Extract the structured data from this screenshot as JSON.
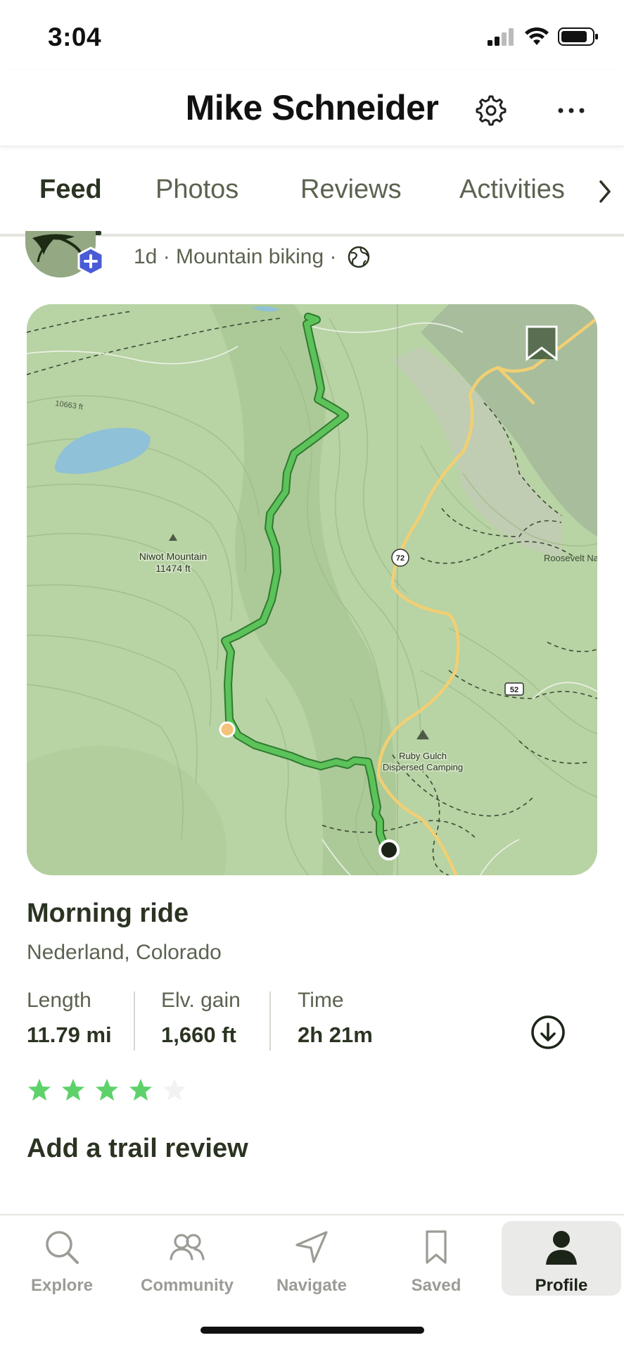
{
  "status_bar": {
    "time": "3:04",
    "icons": [
      "signal-icon",
      "wifi-icon",
      "battery-icon"
    ]
  },
  "header": {
    "title": "Mike Schneider",
    "settings_icon": "gear-icon",
    "more_icon": "ellipsis-icon"
  },
  "tabs": [
    {
      "label": "Feed",
      "active": true
    },
    {
      "label": "Photos",
      "active": false
    },
    {
      "label": "Reviews",
      "active": false
    },
    {
      "label": "Activities",
      "active": false
    }
  ],
  "post": {
    "meta": "1d · Mountain biking ·",
    "visibility_icon": "globe-icon"
  },
  "map": {
    "labels": {
      "elevation": "10663 ft",
      "peak_name": "Niwot Mountain",
      "peak_elevation": "11474 ft",
      "highway_72": "72",
      "highway_52": "52",
      "place": "Roosevelt Na",
      "camp_line1": "Ruby Gulch",
      "camp_line2": "Dispersed Camping"
    },
    "colors": {
      "terrain": "#b8d3a4",
      "route": "#5cc25a",
      "water": "#8fc1d8",
      "road": "#f1cf73"
    }
  },
  "activity": {
    "title": "Morning ride",
    "location": "Nederland, Colorado",
    "stats": [
      {
        "label": "Length",
        "value": "11.79 mi"
      },
      {
        "label": "Elv. gain",
        "value": "1,660 ft"
      },
      {
        "label": "Time",
        "value": "2h 21m"
      }
    ],
    "rating": 4,
    "rating_max": 5,
    "add_review": "Add a trail review"
  },
  "bottom_nav": [
    {
      "label": "Explore",
      "icon": "search-icon",
      "active": false
    },
    {
      "label": "Community",
      "icon": "people-icon",
      "active": false
    },
    {
      "label": "Navigate",
      "icon": "navigate-arrow-icon",
      "active": false
    },
    {
      "label": "Saved",
      "icon": "bookmark-icon",
      "active": false
    },
    {
      "label": "Profile",
      "icon": "person-icon",
      "active": true
    }
  ]
}
